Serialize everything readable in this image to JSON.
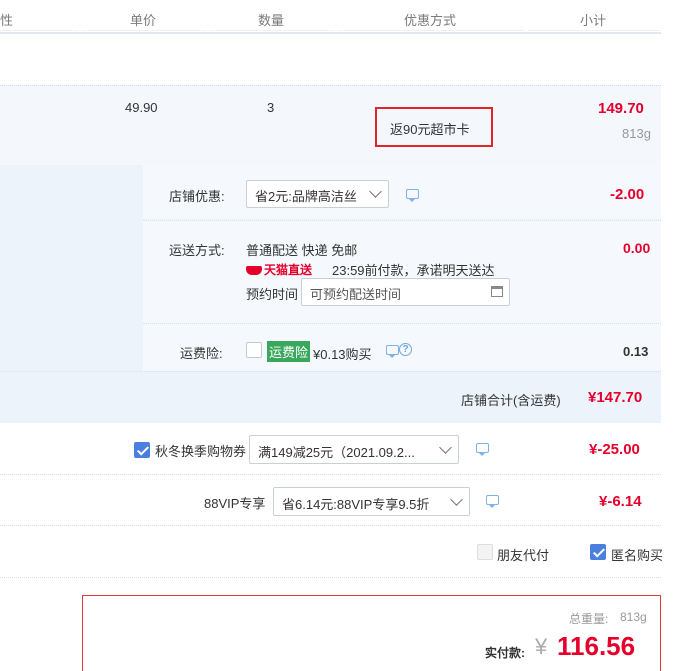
{
  "header": {
    "col_attr": "性",
    "col_price": "单价",
    "col_qty": "数量",
    "col_promo": "优惠方式",
    "col_subtotal": "小计"
  },
  "item": {
    "unit_price": "49.90",
    "quantity": "3",
    "promo_tag": "返90元超市卡",
    "subtotal": "149.70",
    "weight": "813g"
  },
  "shop": {
    "discount_label": "店铺优惠:",
    "discount_select": "省2元:品牌高洁丝",
    "discount_amount": "-2.00",
    "shipping_label": "运送方式:",
    "shipping_text": "普通配送 快递 免邮",
    "tmall_badge": "天猫直送",
    "shipping_promise": "23:59前付款，承诺明天送达",
    "booking_label": "预约时间",
    "booking_placeholder": "可预约配送时间",
    "shipping_amount": "0.00",
    "insurance_label": "运费险:",
    "insurance_badge": "运费险",
    "insurance_text": "¥0.13购买",
    "insurance_amount": "0.13",
    "total_label": "店铺合计(含运费)",
    "total_amount": "¥147.70"
  },
  "coupon": {
    "label": "秋冬换季购物券",
    "select": "满149减25元（2021.09.2...",
    "amount": "¥-25.00"
  },
  "vip": {
    "label": "88VIP专享",
    "select": "省6.14元:88VIP专享9.5折",
    "amount": "¥-6.14"
  },
  "options": {
    "friend_pay": "朋友代付",
    "anonymous": "匿名购买"
  },
  "summary": {
    "weight_label": "总重量:",
    "weight_value": "813g",
    "pay_label": "实付款:",
    "currency": "¥",
    "pay_amount": "116.56"
  },
  "colors": {
    "accent_red": "#e4002b",
    "check_blue": "#4a7fe0",
    "insurance_green": "#3aa85c"
  }
}
